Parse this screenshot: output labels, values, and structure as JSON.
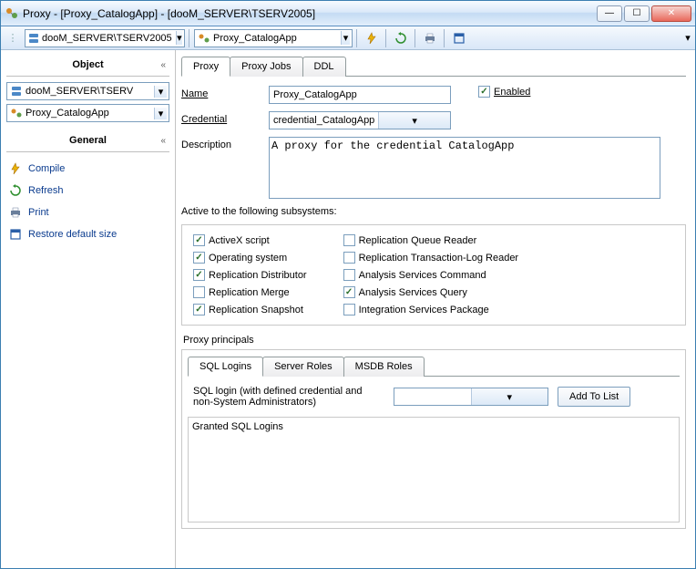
{
  "window": {
    "title": "Proxy - [Proxy_CatalogApp] - [dooM_SERVER\\TSERV2005]"
  },
  "toolbar": {
    "server_combo": "dooM_SERVER\\TSERV2005",
    "proxy_combo": "Proxy_CatalogApp"
  },
  "sidebar": {
    "object_header": "Object",
    "object_items": [
      "dooM_SERVER\\TSERV",
      "Proxy_CatalogApp"
    ],
    "general_header": "General",
    "links": [
      "Compile",
      "Refresh",
      "Print",
      "Restore default size"
    ]
  },
  "tabs": [
    "Proxy",
    "Proxy Jobs",
    "DDL"
  ],
  "form": {
    "name_label": "Name",
    "name_value": "Proxy_CatalogApp",
    "enabled_label": "Enabled",
    "enabled_checked": true,
    "credential_label": "Credential",
    "credential_value": "credential_CatalogApp",
    "description_label": "Description",
    "description_value": "A proxy for the credential CatalogApp"
  },
  "subsystems": {
    "header": "Active to the following subsystems:",
    "left": [
      {
        "label": "ActiveX script",
        "checked": true
      },
      {
        "label": "Operating system",
        "checked": true
      },
      {
        "label": "Replication Distributor",
        "checked": true
      },
      {
        "label": "Replication Merge",
        "checked": false
      },
      {
        "label": "Replication Snapshot",
        "checked": true
      }
    ],
    "right": [
      {
        "label": "Replication Queue Reader",
        "checked": false
      },
      {
        "label": "Replication Transaction-Log Reader",
        "checked": false
      },
      {
        "label": "Analysis Services Command",
        "checked": false
      },
      {
        "label": "Analysis Services Query",
        "checked": true
      },
      {
        "label": "Integration Services Package",
        "checked": false
      }
    ]
  },
  "principals": {
    "header": "Proxy principals",
    "tabs": [
      "SQL Logins",
      "Server Roles",
      "MSDB Roles"
    ],
    "login_label": "SQL login (with defined credential and non-System Administrators)",
    "add_button": "Add To List",
    "list_header": "Granted SQL Logins"
  }
}
